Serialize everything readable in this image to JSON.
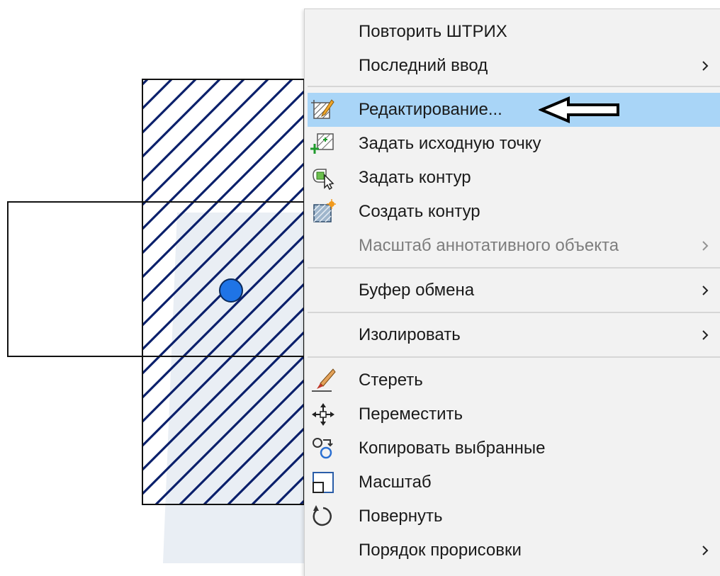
{
  "context_menu": {
    "items": [
      {
        "label": "Повторить ШТРИХ",
        "icon": "none",
        "submenu": false,
        "disabled": false,
        "highlighted": false
      },
      {
        "label": "Последний ввод",
        "icon": "none",
        "submenu": true,
        "disabled": false,
        "highlighted": false
      },
      {
        "label": "Редактирование...",
        "icon": "hatch-edit-icon",
        "submenu": false,
        "disabled": false,
        "highlighted": true
      },
      {
        "label": "Задать исходную точку",
        "icon": "set-origin-icon",
        "submenu": false,
        "disabled": false,
        "highlighted": false
      },
      {
        "label": "Задать контур",
        "icon": "set-boundary-icon",
        "submenu": false,
        "disabled": false,
        "highlighted": false
      },
      {
        "label": "Создать контур",
        "icon": "create-boundary-icon",
        "submenu": false,
        "disabled": false,
        "highlighted": false
      },
      {
        "label": "Масштаб аннотативного объекта",
        "icon": "none",
        "submenu": true,
        "disabled": true,
        "highlighted": false
      },
      {
        "label": "Буфер обмена",
        "icon": "none",
        "submenu": true,
        "disabled": false,
        "highlighted": false
      },
      {
        "label": "Изолировать",
        "icon": "none",
        "submenu": true,
        "disabled": false,
        "highlighted": false
      },
      {
        "label": "Стереть",
        "icon": "eraser-icon",
        "submenu": false,
        "disabled": false,
        "highlighted": false
      },
      {
        "label": "Переместить",
        "icon": "move-icon",
        "submenu": false,
        "disabled": false,
        "highlighted": false
      },
      {
        "label": "Копировать выбранные",
        "icon": "copy-icon",
        "submenu": false,
        "disabled": false,
        "highlighted": false
      },
      {
        "label": "Масштаб",
        "icon": "scale-icon",
        "submenu": false,
        "disabled": false,
        "highlighted": false
      },
      {
        "label": "Повернуть",
        "icon": "rotate-icon",
        "submenu": false,
        "disabled": false,
        "highlighted": false
      },
      {
        "label": "Порядок прорисовки",
        "icon": "none",
        "submenu": true,
        "disabled": false,
        "highlighted": false
      }
    ],
    "highlight_color": "#a9d5f7",
    "background_color": "#f2f2f2"
  },
  "drawing": {
    "hatch_color": "#0a1f6b",
    "grip_color": "#1f74e6",
    "line_color": "#111111"
  },
  "annotation": {
    "arrow": "left-pointing-arrow-icon"
  }
}
